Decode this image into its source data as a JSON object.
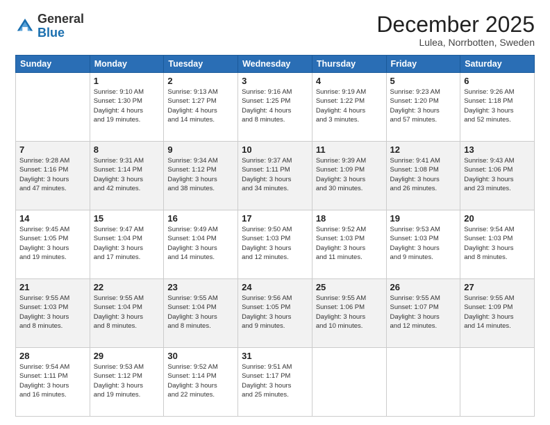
{
  "logo": {
    "general": "General",
    "blue": "Blue"
  },
  "header": {
    "month": "December 2025",
    "location": "Lulea, Norrbotten, Sweden"
  },
  "days_header": [
    "Sunday",
    "Monday",
    "Tuesday",
    "Wednesday",
    "Thursday",
    "Friday",
    "Saturday"
  ],
  "weeks": [
    [
      {
        "day": "",
        "info": ""
      },
      {
        "day": "1",
        "info": "Sunrise: 9:10 AM\nSunset: 1:30 PM\nDaylight: 4 hours\nand 19 minutes."
      },
      {
        "day": "2",
        "info": "Sunrise: 9:13 AM\nSunset: 1:27 PM\nDaylight: 4 hours\nand 14 minutes."
      },
      {
        "day": "3",
        "info": "Sunrise: 9:16 AM\nSunset: 1:25 PM\nDaylight: 4 hours\nand 8 minutes."
      },
      {
        "day": "4",
        "info": "Sunrise: 9:19 AM\nSunset: 1:22 PM\nDaylight: 4 hours\nand 3 minutes."
      },
      {
        "day": "5",
        "info": "Sunrise: 9:23 AM\nSunset: 1:20 PM\nDaylight: 3 hours\nand 57 minutes."
      },
      {
        "day": "6",
        "info": "Sunrise: 9:26 AM\nSunset: 1:18 PM\nDaylight: 3 hours\nand 52 minutes."
      }
    ],
    [
      {
        "day": "7",
        "info": "Sunrise: 9:28 AM\nSunset: 1:16 PM\nDaylight: 3 hours\nand 47 minutes."
      },
      {
        "day": "8",
        "info": "Sunrise: 9:31 AM\nSunset: 1:14 PM\nDaylight: 3 hours\nand 42 minutes."
      },
      {
        "day": "9",
        "info": "Sunrise: 9:34 AM\nSunset: 1:12 PM\nDaylight: 3 hours\nand 38 minutes."
      },
      {
        "day": "10",
        "info": "Sunrise: 9:37 AM\nSunset: 1:11 PM\nDaylight: 3 hours\nand 34 minutes."
      },
      {
        "day": "11",
        "info": "Sunrise: 9:39 AM\nSunset: 1:09 PM\nDaylight: 3 hours\nand 30 minutes."
      },
      {
        "day": "12",
        "info": "Sunrise: 9:41 AM\nSunset: 1:08 PM\nDaylight: 3 hours\nand 26 minutes."
      },
      {
        "day": "13",
        "info": "Sunrise: 9:43 AM\nSunset: 1:06 PM\nDaylight: 3 hours\nand 23 minutes."
      }
    ],
    [
      {
        "day": "14",
        "info": "Sunrise: 9:45 AM\nSunset: 1:05 PM\nDaylight: 3 hours\nand 19 minutes."
      },
      {
        "day": "15",
        "info": "Sunrise: 9:47 AM\nSunset: 1:04 PM\nDaylight: 3 hours\nand 17 minutes."
      },
      {
        "day": "16",
        "info": "Sunrise: 9:49 AM\nSunset: 1:04 PM\nDaylight: 3 hours\nand 14 minutes."
      },
      {
        "day": "17",
        "info": "Sunrise: 9:50 AM\nSunset: 1:03 PM\nDaylight: 3 hours\nand 12 minutes."
      },
      {
        "day": "18",
        "info": "Sunrise: 9:52 AM\nSunset: 1:03 PM\nDaylight: 3 hours\nand 11 minutes."
      },
      {
        "day": "19",
        "info": "Sunrise: 9:53 AM\nSunset: 1:03 PM\nDaylight: 3 hours\nand 9 minutes."
      },
      {
        "day": "20",
        "info": "Sunrise: 9:54 AM\nSunset: 1:03 PM\nDaylight: 3 hours\nand 8 minutes."
      }
    ],
    [
      {
        "day": "21",
        "info": "Sunrise: 9:55 AM\nSunset: 1:03 PM\nDaylight: 3 hours\nand 8 minutes."
      },
      {
        "day": "22",
        "info": "Sunrise: 9:55 AM\nSunset: 1:04 PM\nDaylight: 3 hours\nand 8 minutes."
      },
      {
        "day": "23",
        "info": "Sunrise: 9:55 AM\nSunset: 1:04 PM\nDaylight: 3 hours\nand 8 minutes."
      },
      {
        "day": "24",
        "info": "Sunrise: 9:56 AM\nSunset: 1:05 PM\nDaylight: 3 hours\nand 9 minutes."
      },
      {
        "day": "25",
        "info": "Sunrise: 9:55 AM\nSunset: 1:06 PM\nDaylight: 3 hours\nand 10 minutes."
      },
      {
        "day": "26",
        "info": "Sunrise: 9:55 AM\nSunset: 1:07 PM\nDaylight: 3 hours\nand 12 minutes."
      },
      {
        "day": "27",
        "info": "Sunrise: 9:55 AM\nSunset: 1:09 PM\nDaylight: 3 hours\nand 14 minutes."
      }
    ],
    [
      {
        "day": "28",
        "info": "Sunrise: 9:54 AM\nSunset: 1:11 PM\nDaylight: 3 hours\nand 16 minutes."
      },
      {
        "day": "29",
        "info": "Sunrise: 9:53 AM\nSunset: 1:12 PM\nDaylight: 3 hours\nand 19 minutes."
      },
      {
        "day": "30",
        "info": "Sunrise: 9:52 AM\nSunset: 1:14 PM\nDaylight: 3 hours\nand 22 minutes."
      },
      {
        "day": "31",
        "info": "Sunrise: 9:51 AM\nSunset: 1:17 PM\nDaylight: 3 hours\nand 25 minutes."
      },
      {
        "day": "",
        "info": ""
      },
      {
        "day": "",
        "info": ""
      },
      {
        "day": "",
        "info": ""
      }
    ]
  ]
}
